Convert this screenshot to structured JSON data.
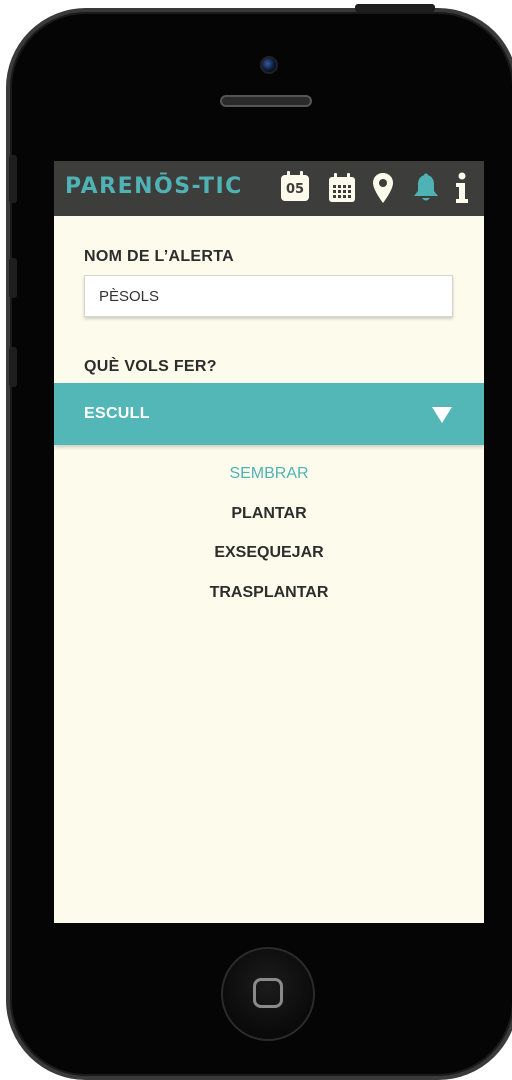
{
  "app": {
    "brand": "PARENŌS-TIC"
  },
  "header": {
    "icons": [
      {
        "name": "calendar-day-icon",
        "text": "05"
      },
      {
        "name": "calendar-icon"
      },
      {
        "name": "location-icon"
      },
      {
        "name": "bell-icon"
      },
      {
        "name": "info-icon"
      }
    ],
    "colors": {
      "bar": "#3d3d3b",
      "accent": "#4fb3b5"
    }
  },
  "form": {
    "name_label": "NOM DE L’ALERTA",
    "name_value": "PÈSOLS",
    "action_label": "QUÈ VOLS FER?",
    "select": {
      "label": "ESCULL",
      "options": [
        "SEMBRAR",
        "PLANTAR",
        "EXSEQUEJAR",
        "TRASPLANTAR"
      ],
      "highlighted": "SEMBRAR"
    }
  }
}
